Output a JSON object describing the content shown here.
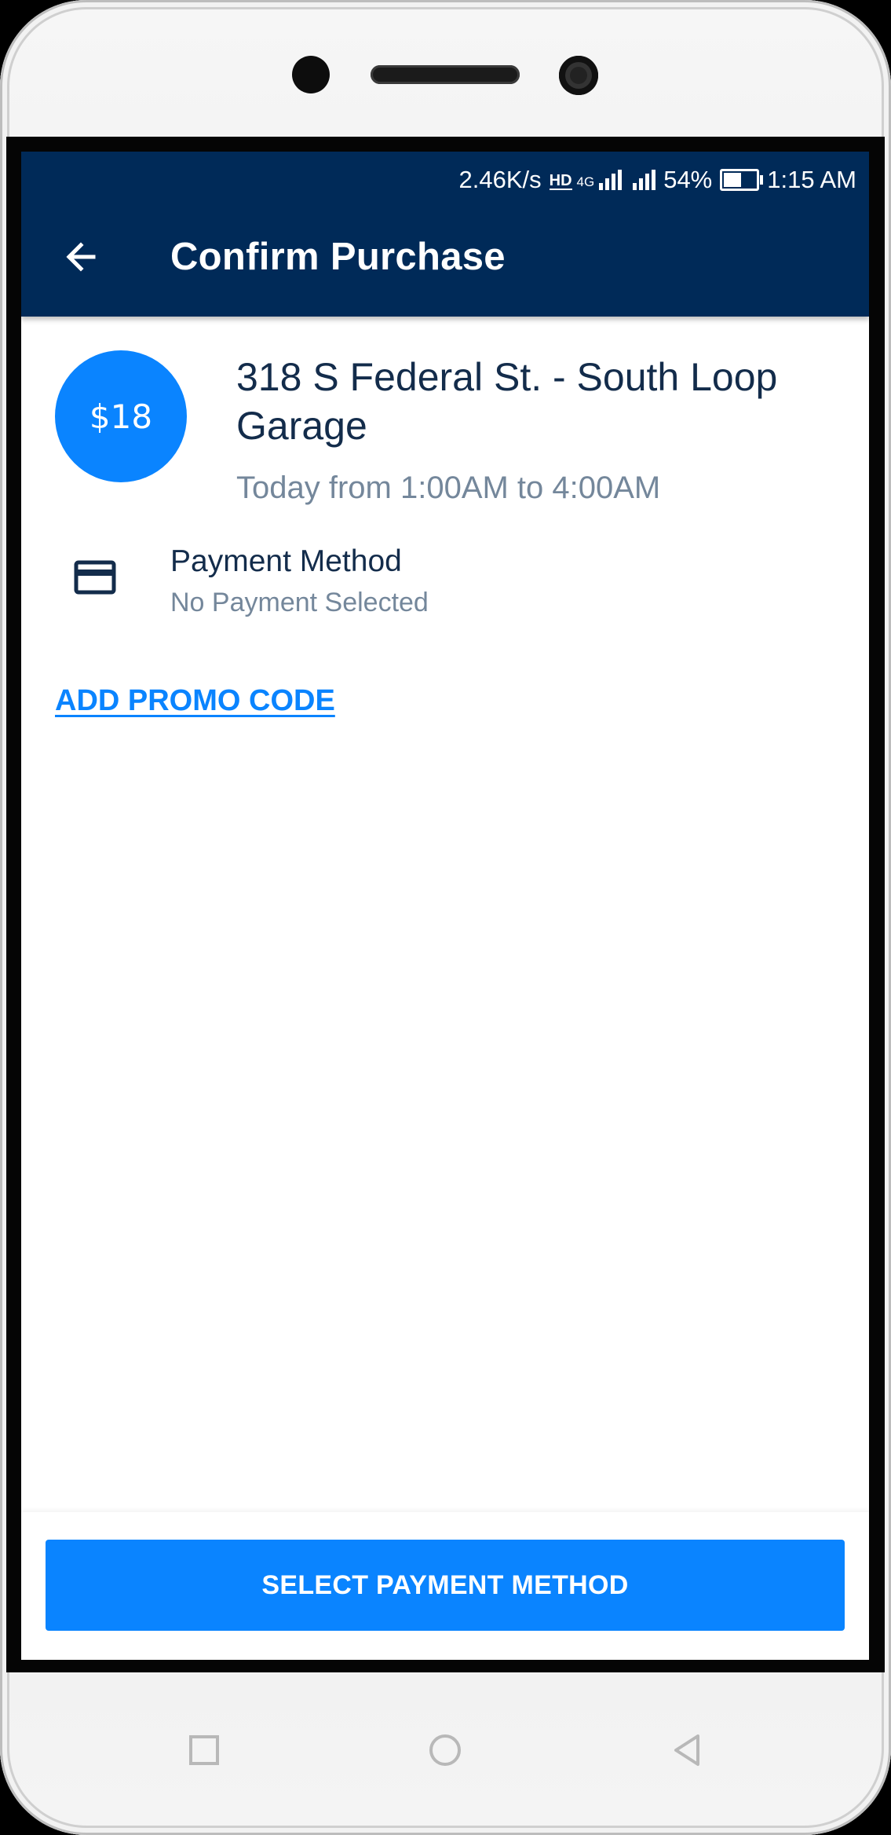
{
  "status_bar": {
    "net_speed": "2.46K/s",
    "hd_label": "HD",
    "network_label": "4G",
    "battery_percent": "54%",
    "battery_level": 0.54,
    "time": "1:15 AM"
  },
  "header": {
    "back_icon": "arrow-left-icon",
    "title": "Confirm Purchase"
  },
  "booking": {
    "price": "$18",
    "location": "318 S Federal St. - South Loop Garage",
    "time_range": "Today from 1:00AM to 4:00AM"
  },
  "payment": {
    "icon": "credit-card-icon",
    "label": "Payment Method",
    "value": "No Payment Selected"
  },
  "promo": {
    "label": "ADD PROMO CODE"
  },
  "footer": {
    "button_label": "SELECT PAYMENT METHOD"
  },
  "nav_keys": [
    "recent-apps-icon",
    "home-icon",
    "back-icon"
  ],
  "colors": {
    "app_bar": "#002a58",
    "accent": "#0a84ff",
    "text_primary": "#132c4b",
    "text_secondary": "#74879b"
  }
}
